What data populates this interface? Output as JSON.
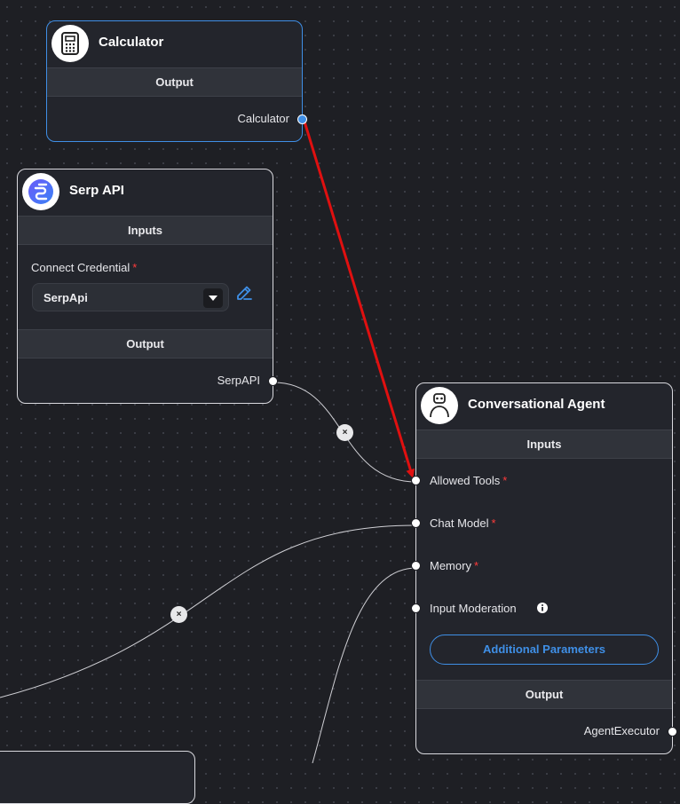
{
  "nodes": {
    "calculator": {
      "title": "Calculator",
      "output_section": "Output",
      "output_label": "Calculator",
      "icon": "calculator-icon"
    },
    "serp": {
      "title": "Serp API",
      "inputs_section": "Inputs",
      "credential_label": "Connect Credential",
      "credential_value": "SerpApi",
      "output_section": "Output",
      "output_label": "SerpAPI",
      "icon": "serp-api-logo"
    },
    "agent": {
      "title": "Conversational Agent",
      "inputs_section": "Inputs",
      "inputs": [
        {
          "label": "Allowed Tools",
          "required": "*"
        },
        {
          "label": "Chat Model",
          "required": "*"
        },
        {
          "label": "Memory",
          "required": "*"
        },
        {
          "label": "Input Moderation",
          "required": ""
        }
      ],
      "additional_params": "Additional Parameters",
      "output_section": "Output",
      "output_label": "AgentExecutor",
      "icon": "robot-icon"
    }
  },
  "edge_delete": "×",
  "colors": {
    "canvas": "#1e1f24",
    "node": "#23252c",
    "accent": "#3f8fe6",
    "required": "#ff3b3b",
    "arrow": "#e01010"
  }
}
